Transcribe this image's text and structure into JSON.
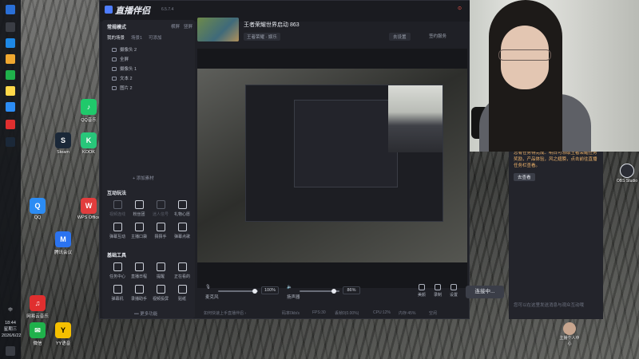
{
  "taskbar": {
    "time": "18:44",
    "weekday": "星期三",
    "date": "2026/6/22",
    "lang": "中"
  },
  "desktop_icons": [
    {
      "label": "微信",
      "color": "#1fb14b"
    },
    {
      "label": "QQ",
      "color": "#2c8cf4"
    },
    {
      "label": "网易云音乐",
      "color": "#e02f2f"
    },
    {
      "label": "Steam",
      "color": "#1b2838"
    },
    {
      "label": "QQ音乐",
      "color": "#20c96b"
    },
    {
      "label": "KOOK",
      "color": "#28c67a"
    },
    {
      "label": "WPS Office",
      "color": "#e23d3d"
    },
    {
      "label": "腾讯会议",
      "color": "#2b73f0"
    },
    {
      "label": "YY语音",
      "color": "#f5c000"
    },
    {
      "label": "OBS Studio",
      "color": "#2b2d35"
    }
  ],
  "app": {
    "brand": "直播伴侣",
    "version": "6.5.7.4",
    "room_title": "王者荣耀世界启动 863",
    "room_tag": "王者荣耀 · 娱乐",
    "edit_label": "去设置",
    "assist_label": "签约服务",
    "warning": "⊙",
    "left": {
      "mode_label": "常规模式",
      "mode_links": [
        "横屏",
        "竖屏"
      ],
      "scene_tabs": [
        "我的场景",
        "场景1",
        "可添加"
      ],
      "scenes": [
        "摄像头 2",
        "全屏",
        "摄像头 1",
        "文本 2",
        "图片 2"
      ],
      "add_source": "+ 添加素材",
      "interactive_title": "互动玩法",
      "interactive_tools": [
        {
          "label": "视频连线",
          "dim": true
        },
        {
          "label": "粉丝团",
          "dim": false
        },
        {
          "label": "迷人信号",
          "dim": true
        },
        {
          "label": "礼物心愿",
          "dim": false
        },
        {
          "label": "弹幕互动",
          "dim": false
        },
        {
          "label": "主播口袋",
          "dim": false
        },
        {
          "label": "猜猜手",
          "dim": false
        },
        {
          "label": "弹幕点歌",
          "dim": false
        }
      ],
      "basic_title": "基础工具",
      "basic_tools": [
        {
          "label": "任务中心",
          "dim": false
        },
        {
          "label": "直播日程",
          "dim": false
        },
        {
          "label": "提醒",
          "dim": false
        },
        {
          "label": "正在看的",
          "dim": false
        },
        {
          "label": "弹幕机",
          "dim": false
        },
        {
          "label": "录播助手",
          "dim": false
        },
        {
          "label": "视频投屏",
          "dim": false
        },
        {
          "label": "贴纸",
          "dim": false
        }
      ],
      "more": "••• 更多功能"
    },
    "mixer": {
      "mic_label": "麦克风",
      "mic_value": "100%",
      "speaker_label": "扬声器",
      "speaker_value": "86%",
      "mic_level": 0.92,
      "speaker_level": 0.86,
      "controls": [
        "美颜",
        "录制",
        "设置"
      ],
      "live_button": "连接中..."
    },
    "status": {
      "left": "如何快速上手直播伴侣 ›",
      "items": [
        "码率0kb/s",
        "FPS:30",
        "丢帧0(0.00%)",
        "CPU:12%",
        "内存:45%",
        "空闲"
      ]
    }
  },
  "chat": {
    "message": "您有任务待完成：明日可领取王者荣耀任务奖励，产品体验，风之翅膀，点击前往直播任务栏查看。",
    "button": "去查看",
    "placeholder": "您可以在这里发送消息与观众互动哦"
  },
  "avatar_label": "主播个人中心",
  "obs_label": "OBS Studio"
}
